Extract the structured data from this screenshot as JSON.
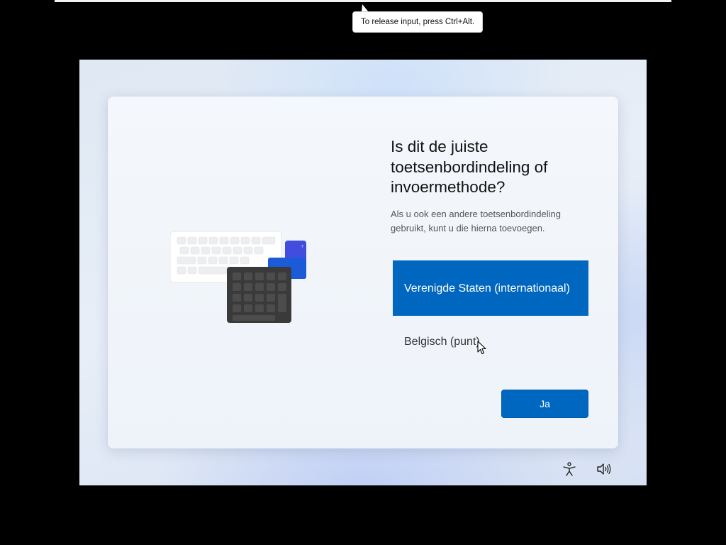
{
  "host": {
    "tooltip": "To release input, press Ctrl+Alt."
  },
  "setup": {
    "title": "Is dit de juiste toetsenbordindeling of invoermethode?",
    "subtitle": "Als u ook een andere toetsenbordindeling gebruikt, kunt u die hierna toevoegen.",
    "options": [
      {
        "label": "Verenigde Staten (internationaal)",
        "selected": true
      },
      {
        "label": "Belgisch (punt)",
        "selected": false
      }
    ],
    "confirm_label": "Ja"
  },
  "tray": {
    "icons": [
      "accessibility-icon",
      "volume-icon"
    ]
  },
  "colors": {
    "accent": "#0067c0",
    "text": "#111111",
    "muted": "#555555"
  }
}
